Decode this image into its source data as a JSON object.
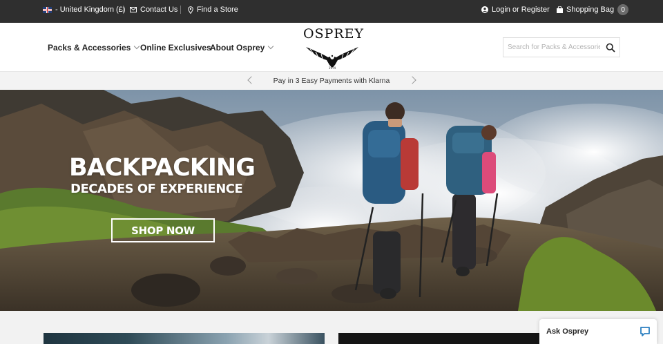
{
  "topbar": {
    "region": "- United Kingdom (£)",
    "contact": "Contact Us",
    "store": "Find a Store",
    "account": "Login or Register",
    "bag_label": "Shopping Bag",
    "bag_count": "0"
  },
  "header": {
    "nav": [
      {
        "label": "Packs & Accessories",
        "has_dropdown": true
      },
      {
        "label": "Online Exclusives",
        "has_dropdown": false
      },
      {
        "label": "About Osprey",
        "has_dropdown": true
      }
    ],
    "logo_text": "OSPREY",
    "search_placeholder": "Search for Packs & Accessories"
  },
  "promo": {
    "text": "Pay in 3 Easy Payments with Klarna"
  },
  "hero": {
    "title": "BACKPACKING",
    "subtitle": "DECADES OF EXPERIENCE",
    "cta": "SHOP NOW"
  },
  "chat": {
    "label": "Ask Osprey"
  },
  "icons": {
    "flag": "uk-flag-icon",
    "contact": "envelope-icon",
    "store": "map-pin-icon",
    "account": "user-icon",
    "bag": "shopping-bag-icon",
    "search": "search-icon",
    "chat": "chat-bubble-icon"
  },
  "colors": {
    "topbar": "#2f2f2f",
    "header": "#ffffff",
    "promo": "#f3f3f3",
    "chat_accent": "#2b7fc0"
  }
}
